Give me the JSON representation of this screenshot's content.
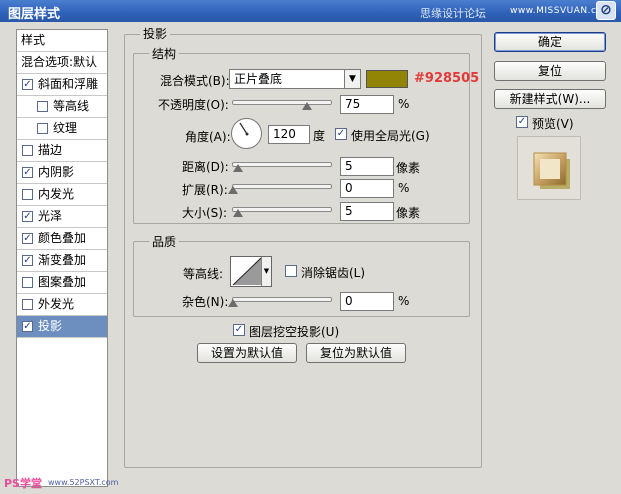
{
  "window": {
    "title": "图层样式",
    "watermark": "思缘设计论坛",
    "watermark_url": "www.MISSVUAN.com"
  },
  "style_list": {
    "header_styles": "样式",
    "header_blend": "混合选项:默认",
    "items": [
      {
        "label": "斜面和浮雕",
        "checked": true
      },
      {
        "label": "等高线",
        "checked": false
      },
      {
        "label": "纹理",
        "checked": false
      },
      {
        "label": "描边",
        "checked": false
      },
      {
        "label": "内阴影",
        "checked": true
      },
      {
        "label": "内发光",
        "checked": false
      },
      {
        "label": "光泽",
        "checked": true
      },
      {
        "label": "颜色叠加",
        "checked": true
      },
      {
        "label": "渐变叠加",
        "checked": true
      },
      {
        "label": "图案叠加",
        "checked": false
      },
      {
        "label": "外发光",
        "checked": false
      },
      {
        "label": "投影",
        "checked": true
      }
    ]
  },
  "panel": {
    "title": "投影",
    "structure": {
      "legend": "结构",
      "blend_mode_label": "混合模式(B):",
      "blend_mode_value": "正片叠底",
      "color_hex": "#928505",
      "color_label": "#928505",
      "opacity_label": "不透明度(O):",
      "opacity_value": "75",
      "opacity_unit": "%",
      "angle_label": "角度(A):",
      "angle_value": "120",
      "angle_unit": "度",
      "global_light_label": "使用全局光(G)",
      "global_light_checked": true,
      "distance_label": "距离(D):",
      "distance_value": "5",
      "distance_unit": "像素",
      "spread_label": "扩展(R):",
      "spread_value": "0",
      "spread_unit": "%",
      "size_label": "大小(S):",
      "size_value": "5",
      "size_unit": "像素"
    },
    "quality": {
      "legend": "品质",
      "contour_label": "等高线:",
      "antialias_label": "消除锯齿(L)",
      "antialias_checked": false,
      "noise_label": "杂色(N):",
      "noise_value": "0",
      "noise_unit": "%"
    },
    "knockout_label": "图层挖空投影(U)",
    "knockout_checked": true,
    "make_default_button": "设置为默认值",
    "reset_default_button": "复位为默认值"
  },
  "side_buttons": {
    "ok": "确定",
    "reset": "复位",
    "new_style": "新建样式(W)...",
    "preview_label": "预览(V)",
    "preview_checked": true
  },
  "footer": {
    "ps_logo": "PS学堂",
    "ps_url": "www.52PSXT.com"
  }
}
